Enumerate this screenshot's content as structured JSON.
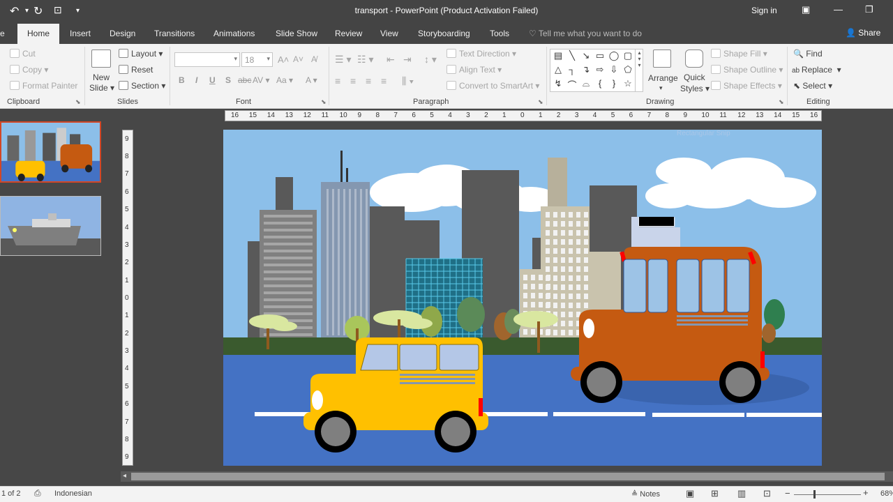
{
  "titlebar": {
    "doc_title": "transport  -  PowerPoint (Product Activation Failed)",
    "sign_in": "Sign in"
  },
  "tabs": {
    "file": "e",
    "items": [
      "Home",
      "Insert",
      "Design",
      "Transitions",
      "Animations",
      "Slide Show",
      "Review",
      "View",
      "Storyboarding",
      "Tools"
    ],
    "tell_me": "Tell me what you want to do",
    "share": "Share"
  },
  "ribbon": {
    "clipboard": {
      "label": "Clipboard",
      "cut": "Cut",
      "copy": "Copy",
      "format_painter": "Format Painter"
    },
    "slides": {
      "label": "Slides",
      "new_slide_1": "New",
      "new_slide_2": "Slide",
      "layout": "Layout",
      "reset": "Reset",
      "section": "Section"
    },
    "font": {
      "label": "Font",
      "font_name": "",
      "font_size": "18"
    },
    "paragraph": {
      "label": "Paragraph",
      "text_direction": "Text Direction",
      "align_text": "Align Text",
      "convert_smartart": "Convert to SmartArt"
    },
    "drawing": {
      "label": "Drawing",
      "arrange": "Arrange",
      "quick_styles_1": "Quick",
      "quick_styles_2": "Styles",
      "shape_fill": "Shape Fill",
      "shape_outline": "Shape Outline",
      "shape_effects": "Shape Effects"
    },
    "editing": {
      "label": "Editing",
      "find": "Find",
      "replace": "Replace",
      "select": "Select"
    }
  },
  "rulers": {
    "horizontal": [
      "16",
      "15",
      "14",
      "13",
      "12",
      "11",
      "10",
      "9",
      "8",
      "7",
      "6",
      "5",
      "4",
      "3",
      "2",
      "1",
      "0",
      "1",
      "2",
      "3",
      "4",
      "5",
      "6",
      "7",
      "8",
      "9",
      "10",
      "11",
      "12",
      "13",
      "14",
      "15",
      "16"
    ],
    "vertical": [
      "9",
      "8",
      "7",
      "6",
      "5",
      "4",
      "3",
      "2",
      "1",
      "0",
      "1",
      "2",
      "3",
      "4",
      "5",
      "6",
      "7",
      "8",
      "9"
    ]
  },
  "slide": {
    "ghost_text": "Rectangular Snip"
  },
  "statusbar": {
    "slide_count": "1 of 2",
    "language": "Indonesian",
    "notes": "Notes",
    "zoom": "68%"
  },
  "colors": {
    "accent": "#d24726",
    "sky": "#8cbfe9",
    "road": "#4472c4",
    "bus": "#c55a11",
    "car": "#ffc000"
  }
}
